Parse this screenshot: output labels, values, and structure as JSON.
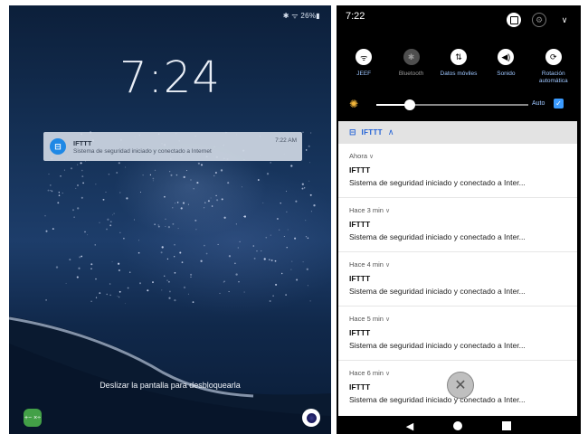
{
  "lock_screen": {
    "status_text": "✱ ᯤ 26%▮",
    "time": "7:24",
    "notification": {
      "app_letter": "⊟",
      "title": "IFTTT",
      "body": "Sistema de seguridad iniciado y conectado a Internet",
      "time": "7:22 AM"
    },
    "unlock_hint": "Deslizar la pantalla para desbloquearla",
    "calc_glyph": "+− ×÷"
  },
  "shade": {
    "time": "7:22",
    "quick_settings": [
      {
        "label": "JEEF",
        "icon": "wifi-icon",
        "glyph": "ᯤ",
        "on": true
      },
      {
        "label": "Bluetooth",
        "icon": "bluetooth-icon",
        "glyph": "✱",
        "on": false
      },
      {
        "label": "Datos móviles",
        "icon": "mobile-data-icon",
        "glyph": "⇅",
        "on": true
      },
      {
        "label": "Sonido",
        "icon": "sound-icon",
        "glyph": "◀)",
        "on": true
      },
      {
        "label": "Rotación automática",
        "icon": "rotate-icon",
        "glyph": "⟳",
        "on": true
      }
    ],
    "brightness": {
      "level": 0.22,
      "auto_label": "Auto",
      "auto_checked": true
    },
    "panel_header": {
      "app_name": "IFTTT",
      "logo": "⊟"
    },
    "notifications": [
      {
        "time": "Ahora",
        "title": "IFTTT",
        "body": "Sistema de seguridad iniciado y conectado a Inter..."
      },
      {
        "time": "Hace 3 min",
        "title": "IFTTT",
        "body": "Sistema de seguridad iniciado y conectado a Inter..."
      },
      {
        "time": "Hace 4 min",
        "title": "IFTTT",
        "body": "Sistema de seguridad iniciado y conectado a Inter..."
      },
      {
        "time": "Hace 5 min",
        "title": "IFTTT",
        "body": "Sistema de seguridad iniciado y conectado a Inter..."
      },
      {
        "time": "Hace 6 min",
        "title": "IFTTT",
        "body": "Sistema de seguridad iniciado y conectado a Inter..."
      }
    ],
    "chevron_glyph": "∨"
  },
  "colors": {
    "accent_blue": "#1e5fd6",
    "label_blue": "#9ec6ff",
    "sun_yellow": "#f3b63a"
  }
}
